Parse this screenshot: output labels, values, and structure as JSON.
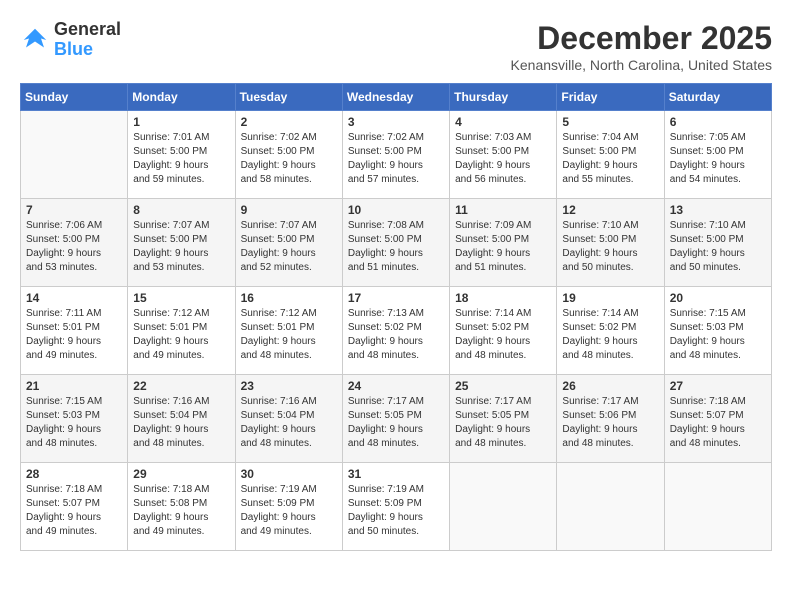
{
  "logo": {
    "line1": "General",
    "line2": "Blue"
  },
  "title": {
    "month_year": "December 2025",
    "location": "Kenansville, North Carolina, United States"
  },
  "days_of_week": [
    "Sunday",
    "Monday",
    "Tuesday",
    "Wednesday",
    "Thursday",
    "Friday",
    "Saturday"
  ],
  "weeks": [
    [
      {
        "day": "",
        "info": ""
      },
      {
        "day": "1",
        "info": "Sunrise: 7:01 AM\nSunset: 5:00 PM\nDaylight: 9 hours\nand 59 minutes."
      },
      {
        "day": "2",
        "info": "Sunrise: 7:02 AM\nSunset: 5:00 PM\nDaylight: 9 hours\nand 58 minutes."
      },
      {
        "day": "3",
        "info": "Sunrise: 7:02 AM\nSunset: 5:00 PM\nDaylight: 9 hours\nand 57 minutes."
      },
      {
        "day": "4",
        "info": "Sunrise: 7:03 AM\nSunset: 5:00 PM\nDaylight: 9 hours\nand 56 minutes."
      },
      {
        "day": "5",
        "info": "Sunrise: 7:04 AM\nSunset: 5:00 PM\nDaylight: 9 hours\nand 55 minutes."
      },
      {
        "day": "6",
        "info": "Sunrise: 7:05 AM\nSunset: 5:00 PM\nDaylight: 9 hours\nand 54 minutes."
      }
    ],
    [
      {
        "day": "7",
        "info": "Sunrise: 7:06 AM\nSunset: 5:00 PM\nDaylight: 9 hours\nand 53 minutes."
      },
      {
        "day": "8",
        "info": "Sunrise: 7:07 AM\nSunset: 5:00 PM\nDaylight: 9 hours\nand 53 minutes."
      },
      {
        "day": "9",
        "info": "Sunrise: 7:07 AM\nSunset: 5:00 PM\nDaylight: 9 hours\nand 52 minutes."
      },
      {
        "day": "10",
        "info": "Sunrise: 7:08 AM\nSunset: 5:00 PM\nDaylight: 9 hours\nand 51 minutes."
      },
      {
        "day": "11",
        "info": "Sunrise: 7:09 AM\nSunset: 5:00 PM\nDaylight: 9 hours\nand 51 minutes."
      },
      {
        "day": "12",
        "info": "Sunrise: 7:10 AM\nSunset: 5:00 PM\nDaylight: 9 hours\nand 50 minutes."
      },
      {
        "day": "13",
        "info": "Sunrise: 7:10 AM\nSunset: 5:00 PM\nDaylight: 9 hours\nand 50 minutes."
      }
    ],
    [
      {
        "day": "14",
        "info": "Sunrise: 7:11 AM\nSunset: 5:01 PM\nDaylight: 9 hours\nand 49 minutes."
      },
      {
        "day": "15",
        "info": "Sunrise: 7:12 AM\nSunset: 5:01 PM\nDaylight: 9 hours\nand 49 minutes."
      },
      {
        "day": "16",
        "info": "Sunrise: 7:12 AM\nSunset: 5:01 PM\nDaylight: 9 hours\nand 48 minutes."
      },
      {
        "day": "17",
        "info": "Sunrise: 7:13 AM\nSunset: 5:02 PM\nDaylight: 9 hours\nand 48 minutes."
      },
      {
        "day": "18",
        "info": "Sunrise: 7:14 AM\nSunset: 5:02 PM\nDaylight: 9 hours\nand 48 minutes."
      },
      {
        "day": "19",
        "info": "Sunrise: 7:14 AM\nSunset: 5:02 PM\nDaylight: 9 hours\nand 48 minutes."
      },
      {
        "day": "20",
        "info": "Sunrise: 7:15 AM\nSunset: 5:03 PM\nDaylight: 9 hours\nand 48 minutes."
      }
    ],
    [
      {
        "day": "21",
        "info": "Sunrise: 7:15 AM\nSunset: 5:03 PM\nDaylight: 9 hours\nand 48 minutes."
      },
      {
        "day": "22",
        "info": "Sunrise: 7:16 AM\nSunset: 5:04 PM\nDaylight: 9 hours\nand 48 minutes."
      },
      {
        "day": "23",
        "info": "Sunrise: 7:16 AM\nSunset: 5:04 PM\nDaylight: 9 hours\nand 48 minutes."
      },
      {
        "day": "24",
        "info": "Sunrise: 7:17 AM\nSunset: 5:05 PM\nDaylight: 9 hours\nand 48 minutes."
      },
      {
        "day": "25",
        "info": "Sunrise: 7:17 AM\nSunset: 5:05 PM\nDaylight: 9 hours\nand 48 minutes."
      },
      {
        "day": "26",
        "info": "Sunrise: 7:17 AM\nSunset: 5:06 PM\nDaylight: 9 hours\nand 48 minutes."
      },
      {
        "day": "27",
        "info": "Sunrise: 7:18 AM\nSunset: 5:07 PM\nDaylight: 9 hours\nand 48 minutes."
      }
    ],
    [
      {
        "day": "28",
        "info": "Sunrise: 7:18 AM\nSunset: 5:07 PM\nDaylight: 9 hours\nand 49 minutes."
      },
      {
        "day": "29",
        "info": "Sunrise: 7:18 AM\nSunset: 5:08 PM\nDaylight: 9 hours\nand 49 minutes."
      },
      {
        "day": "30",
        "info": "Sunrise: 7:19 AM\nSunset: 5:09 PM\nDaylight: 9 hours\nand 49 minutes."
      },
      {
        "day": "31",
        "info": "Sunrise: 7:19 AM\nSunset: 5:09 PM\nDaylight: 9 hours\nand 50 minutes."
      },
      {
        "day": "",
        "info": ""
      },
      {
        "day": "",
        "info": ""
      },
      {
        "day": "",
        "info": ""
      }
    ]
  ]
}
